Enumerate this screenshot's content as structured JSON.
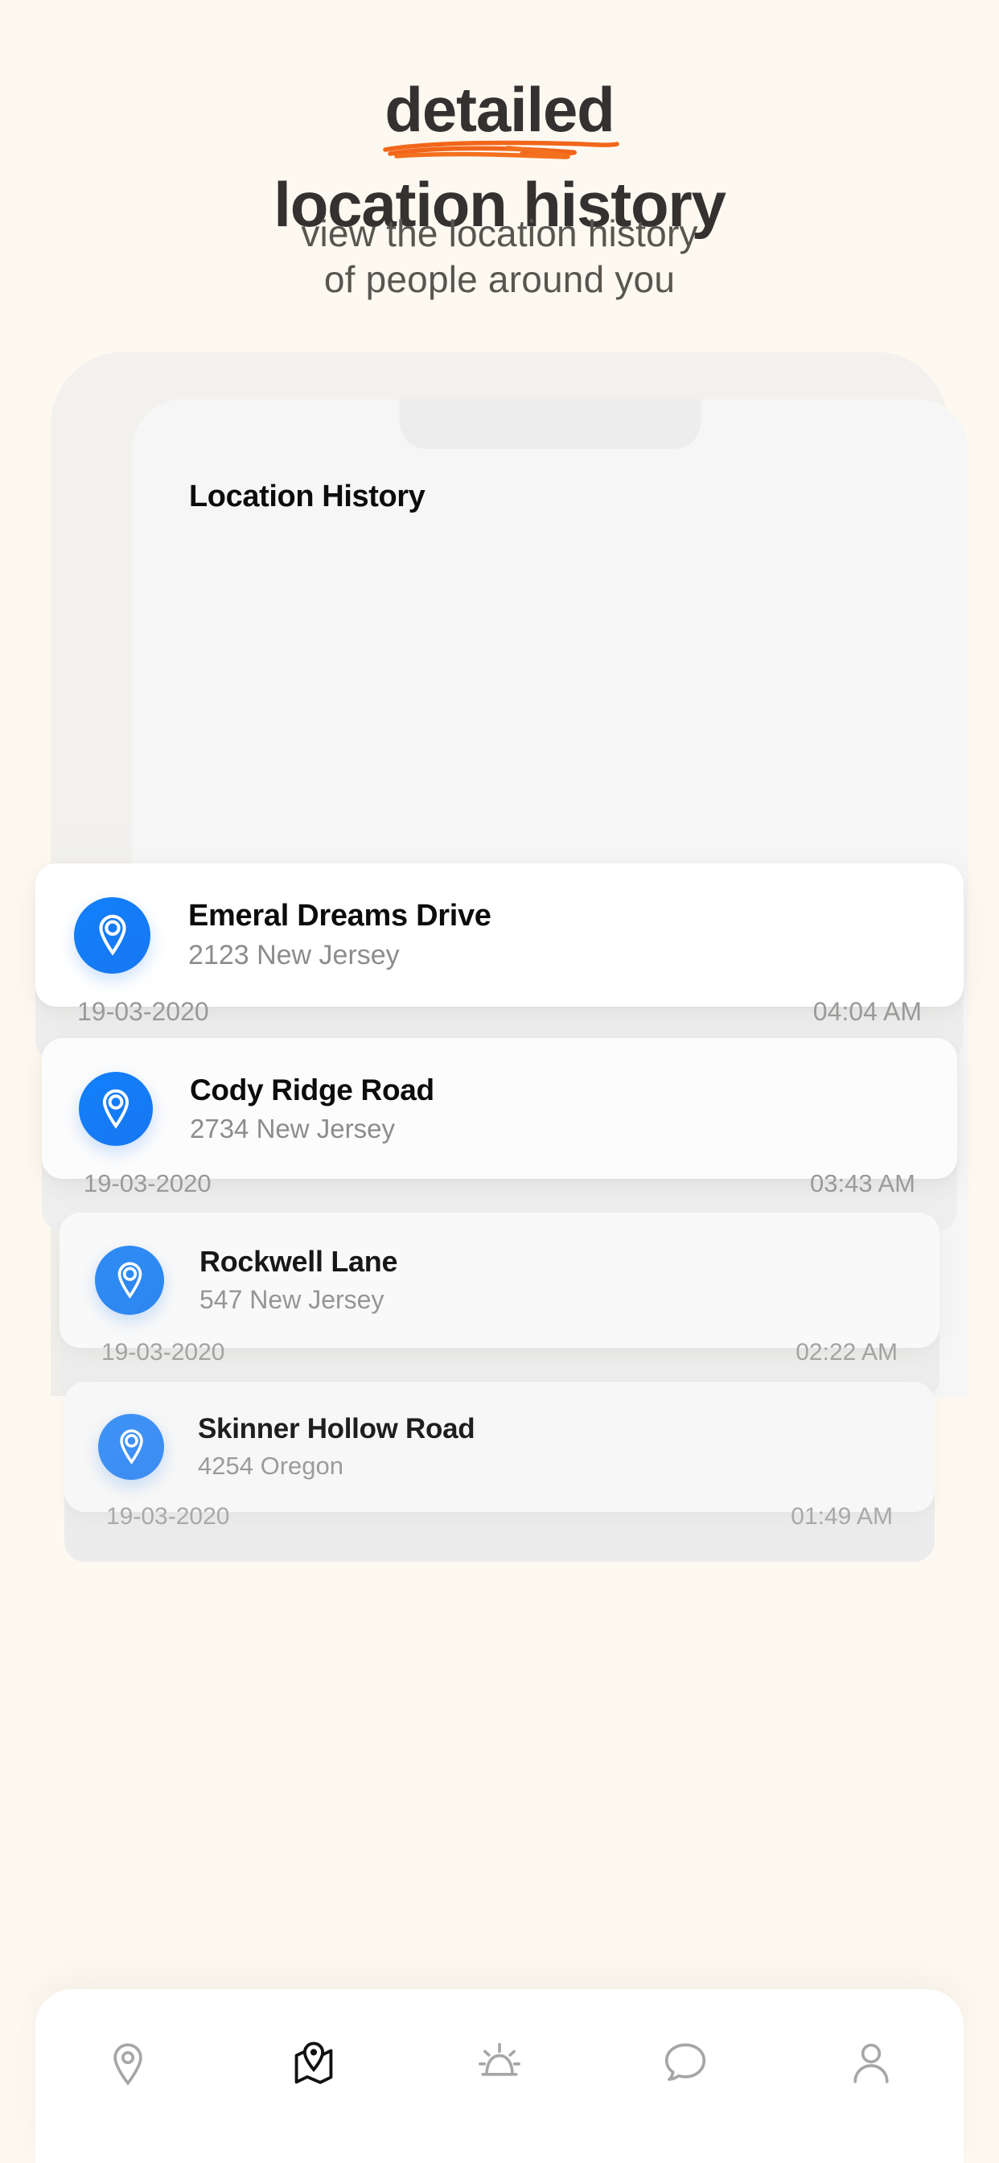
{
  "hero": {
    "headline_line1": "detailed",
    "headline_line2": "location history",
    "subtitle_line1": "view the location history",
    "subtitle_line2": "of people around you",
    "accent_color": "#F26C22",
    "headline_color": "#333230",
    "subtitle_color": "#57564F",
    "background_color": "#FDF9F1"
  },
  "phone": {
    "screen_title": "Location History",
    "brand_blue": "#1877F2"
  },
  "history": {
    "items": [
      {
        "icon": "location-pin-icon",
        "name": "Emeral Dreams Drive",
        "address": "2123 New Jersey",
        "date": "19-03-2020",
        "time": "04:04 AM"
      },
      {
        "icon": "location-pin-icon",
        "name": "Cody Ridge Road",
        "address": "2734 New Jersey",
        "date": "19-03-2020",
        "time": "03:43 AM"
      },
      {
        "icon": "location-pin-icon",
        "name": "Rockwell Lane",
        "address": "547 New Jersey",
        "date": "19-03-2020",
        "time": "02:22 AM"
      },
      {
        "icon": "location-pin-icon",
        "name": "Skinner Hollow Road",
        "address": "4254 Oregon",
        "date": "19-03-2020",
        "time": "01:49 AM"
      }
    ]
  },
  "bottom_nav": {
    "items": [
      {
        "icon": "location-pin-outline-icon",
        "active": false
      },
      {
        "icon": "map-pin-icon",
        "active": true
      },
      {
        "icon": "alarm-icon",
        "active": false
      },
      {
        "icon": "chat-bubble-icon",
        "active": false
      },
      {
        "icon": "person-icon",
        "active": false
      }
    ]
  }
}
